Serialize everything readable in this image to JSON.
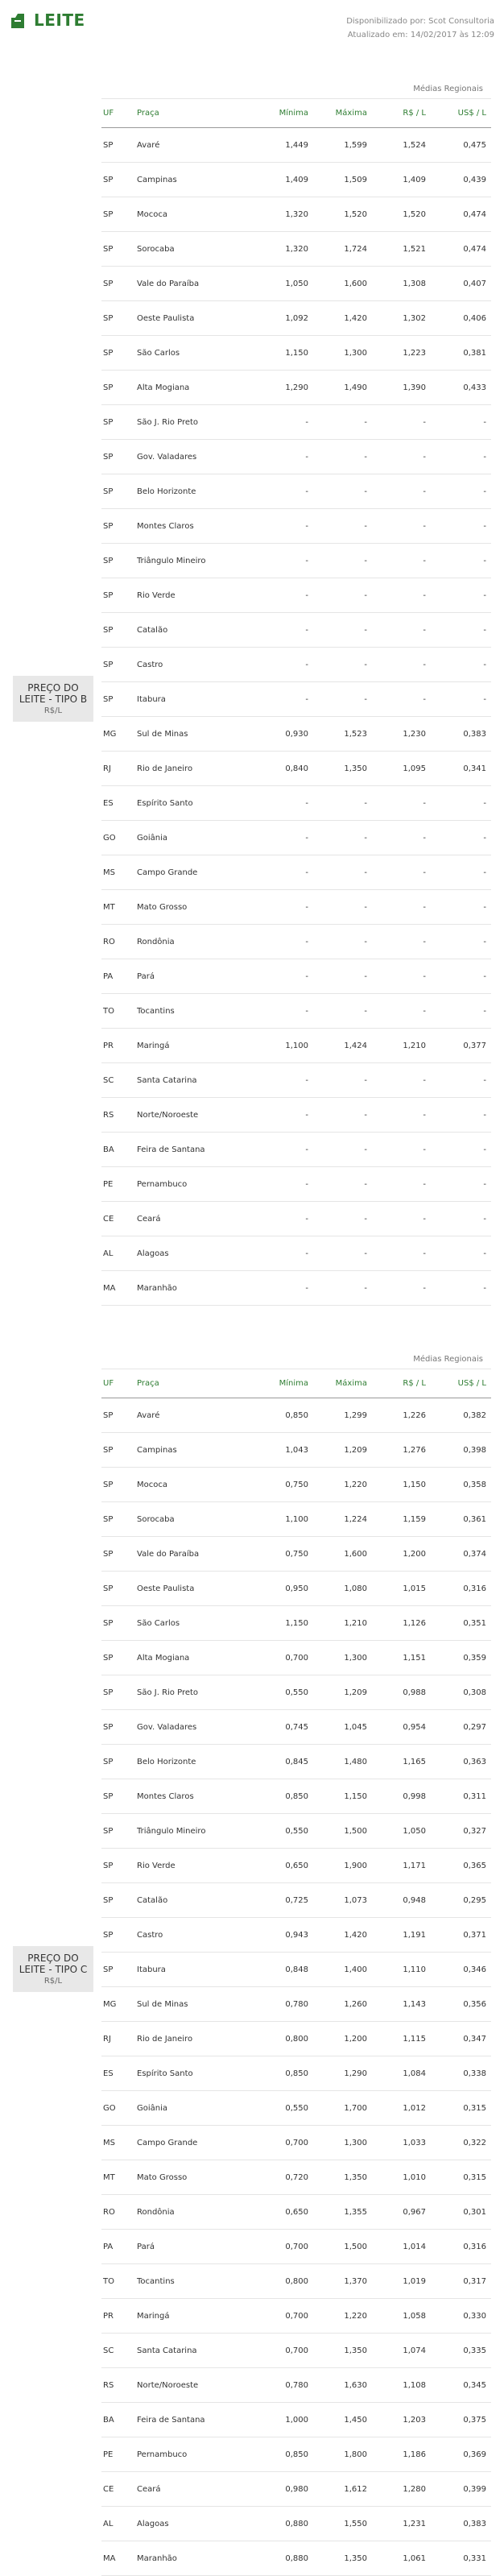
{
  "brand": "LEITE",
  "source": "Disponibilizado por: Scot Consultoria",
  "updated": "Atualizado em: 14/02/2017 às 12:09",
  "sections": [
    {
      "label_line1": "PREÇO DO",
      "label_line2": "LEITE - TIPO B",
      "unit": "R$/L",
      "regional": "Médias Regionais",
      "headers": {
        "uf": "UF",
        "praca": "Praça",
        "min": "Mínima",
        "max": "Máxima",
        "brl": "R$ / L",
        "usd": "US$ / L"
      },
      "rows": [
        [
          "SP",
          "Avaré",
          "1,449",
          "1,599",
          "1,524",
          "0,475"
        ],
        [
          "SP",
          "Campinas",
          "1,409",
          "1,509",
          "1,409",
          "0,439"
        ],
        [
          "SP",
          "Mococa",
          "1,320",
          "1,520",
          "1,520",
          "0,474"
        ],
        [
          "SP",
          "Sorocaba",
          "1,320",
          "1,724",
          "1,521",
          "0,474"
        ],
        [
          "SP",
          "Vale do Paraíba",
          "1,050",
          "1,600",
          "1,308",
          "0,407"
        ],
        [
          "SP",
          "Oeste Paulista",
          "1,092",
          "1,420",
          "1,302",
          "0,406"
        ],
        [
          "SP",
          "São Carlos",
          "1,150",
          "1,300",
          "1,223",
          "0,381"
        ],
        [
          "SP",
          "Alta Mogiana",
          "1,290",
          "1,490",
          "1,390",
          "0,433"
        ],
        [
          "SP",
          "São J. Rio Preto",
          "-",
          "-",
          "-",
          "-"
        ],
        [
          "SP",
          "Gov. Valadares",
          "-",
          "-",
          "-",
          "-"
        ],
        [
          "SP",
          "Belo Horizonte",
          "-",
          "-",
          "-",
          "-"
        ],
        [
          "SP",
          "Montes Claros",
          "-",
          "-",
          "-",
          "-"
        ],
        [
          "SP",
          "Triângulo Mineiro",
          "-",
          "-",
          "-",
          "-"
        ],
        [
          "SP",
          "Rio Verde",
          "-",
          "-",
          "-",
          "-"
        ],
        [
          "SP",
          "Catalão",
          "-",
          "-",
          "-",
          "-"
        ],
        [
          "SP",
          "Castro",
          "-",
          "-",
          "-",
          "-"
        ],
        [
          "SP",
          "Itabura",
          "-",
          "-",
          "-",
          "-"
        ],
        [
          "MG",
          "Sul de Minas",
          "0,930",
          "1,523",
          "1,230",
          "0,383"
        ],
        [
          "RJ",
          "Rio de Janeiro",
          "0,840",
          "1,350",
          "1,095",
          "0,341"
        ],
        [
          "ES",
          "Espírito Santo",
          "-",
          "-",
          "-",
          "-"
        ],
        [
          "GO",
          "Goiânia",
          "-",
          "-",
          "-",
          "-"
        ],
        [
          "MS",
          "Campo Grande",
          "-",
          "-",
          "-",
          "-"
        ],
        [
          "MT",
          "Mato Grosso",
          "-",
          "-",
          "-",
          "-"
        ],
        [
          "RO",
          "Rondônia",
          "-",
          "-",
          "-",
          "-"
        ],
        [
          "PA",
          "Pará",
          "-",
          "-",
          "-",
          "-"
        ],
        [
          "TO",
          "Tocantins",
          "-",
          "-",
          "-",
          "-"
        ],
        [
          "PR",
          "Maringá",
          "1,100",
          "1,424",
          "1,210",
          "0,377"
        ],
        [
          "SC",
          "Santa Catarina",
          "-",
          "-",
          "-",
          "-"
        ],
        [
          "RS",
          "Norte/Noroeste",
          "-",
          "-",
          "-",
          "-"
        ],
        [
          "BA",
          "Feira de Santana",
          "-",
          "-",
          "-",
          "-"
        ],
        [
          "PE",
          "Pernambuco",
          "-",
          "-",
          "-",
          "-"
        ],
        [
          "CE",
          "Ceará",
          "-",
          "-",
          "-",
          "-"
        ],
        [
          "AL",
          "Alagoas",
          "-",
          "-",
          "-",
          "-"
        ],
        [
          "MA",
          "Maranhão",
          "-",
          "-",
          "-",
          "-"
        ]
      ]
    },
    {
      "label_line1": "PREÇO DO",
      "label_line2": "LEITE - TIPO C",
      "unit": "R$/L",
      "regional": "Médias Regionais",
      "headers": {
        "uf": "UF",
        "praca": "Praça",
        "min": "Mínima",
        "max": "Máxima",
        "brl": "R$ / L",
        "usd": "US$ / L"
      },
      "rows": [
        [
          "SP",
          "Avaré",
          "0,850",
          "1,299",
          "1,226",
          "0,382"
        ],
        [
          "SP",
          "Campinas",
          "1,043",
          "1,209",
          "1,276",
          "0,398"
        ],
        [
          "SP",
          "Mococa",
          "0,750",
          "1,220",
          "1,150",
          "0,358"
        ],
        [
          "SP",
          "Sorocaba",
          "1,100",
          "1,224",
          "1,159",
          "0,361"
        ],
        [
          "SP",
          "Vale do Paraíba",
          "0,750",
          "1,600",
          "1,200",
          "0,374"
        ],
        [
          "SP",
          "Oeste Paulista",
          "0,950",
          "1,080",
          "1,015",
          "0,316"
        ],
        [
          "SP",
          "São Carlos",
          "1,150",
          "1,210",
          "1,126",
          "0,351"
        ],
        [
          "SP",
          "Alta Mogiana",
          "0,700",
          "1,300",
          "1,151",
          "0,359"
        ],
        [
          "SP",
          "São J. Rio Preto",
          "0,550",
          "1,209",
          "0,988",
          "0,308"
        ],
        [
          "SP",
          "Gov. Valadares",
          "0,745",
          "1,045",
          "0,954",
          "0,297"
        ],
        [
          "SP",
          "Belo Horizonte",
          "0,845",
          "1,480",
          "1,165",
          "0,363"
        ],
        [
          "SP",
          "Montes Claros",
          "0,850",
          "1,150",
          "0,998",
          "0,311"
        ],
        [
          "SP",
          "Triângulo Mineiro",
          "0,550",
          "1,500",
          "1,050",
          "0,327"
        ],
        [
          "SP",
          "Rio Verde",
          "0,650",
          "1,900",
          "1,171",
          "0,365"
        ],
        [
          "SP",
          "Catalão",
          "0,725",
          "1,073",
          "0,948",
          "0,295"
        ],
        [
          "SP",
          "Castro",
          "0,943",
          "1,420",
          "1,191",
          "0,371"
        ],
        [
          "SP",
          "Itabura",
          "0,848",
          "1,400",
          "1,110",
          "0,346"
        ],
        [
          "MG",
          "Sul de Minas",
          "0,780",
          "1,260",
          "1,143",
          "0,356"
        ],
        [
          "RJ",
          "Rio de Janeiro",
          "0,800",
          "1,200",
          "1,115",
          "0,347"
        ],
        [
          "ES",
          "Espírito Santo",
          "0,850",
          "1,290",
          "1,084",
          "0,338"
        ],
        [
          "GO",
          "Goiânia",
          "0,550",
          "1,700",
          "1,012",
          "0,315"
        ],
        [
          "MS",
          "Campo Grande",
          "0,700",
          "1,300",
          "1,033",
          "0,322"
        ],
        [
          "MT",
          "Mato Grosso",
          "0,720",
          "1,350",
          "1,010",
          "0,315"
        ],
        [
          "RO",
          "Rondônia",
          "0,650",
          "1,355",
          "0,967",
          "0,301"
        ],
        [
          "PA",
          "Pará",
          "0,700",
          "1,500",
          "1,014",
          "0,316"
        ],
        [
          "TO",
          "Tocantins",
          "0,800",
          "1,370",
          "1,019",
          "0,317"
        ],
        [
          "PR",
          "Maringá",
          "0,700",
          "1,220",
          "1,058",
          "0,330"
        ],
        [
          "SC",
          "Santa Catarina",
          "0,700",
          "1,350",
          "1,074",
          "0,335"
        ],
        [
          "RS",
          "Norte/Noroeste",
          "0,780",
          "1,630",
          "1,108",
          "0,345"
        ],
        [
          "BA",
          "Feira de Santana",
          "1,000",
          "1,450",
          "1,203",
          "0,375"
        ],
        [
          "PE",
          "Pernambuco",
          "0,850",
          "1,800",
          "1,186",
          "0,369"
        ],
        [
          "CE",
          "Ceará",
          "0,980",
          "1,612",
          "1,280",
          "0,399"
        ],
        [
          "AL",
          "Alagoas",
          "0,880",
          "1,550",
          "1,231",
          "0,383"
        ],
        [
          "MA",
          "Maranhão",
          "0,880",
          "1,350",
          "1,061",
          "0,331"
        ]
      ]
    }
  ]
}
